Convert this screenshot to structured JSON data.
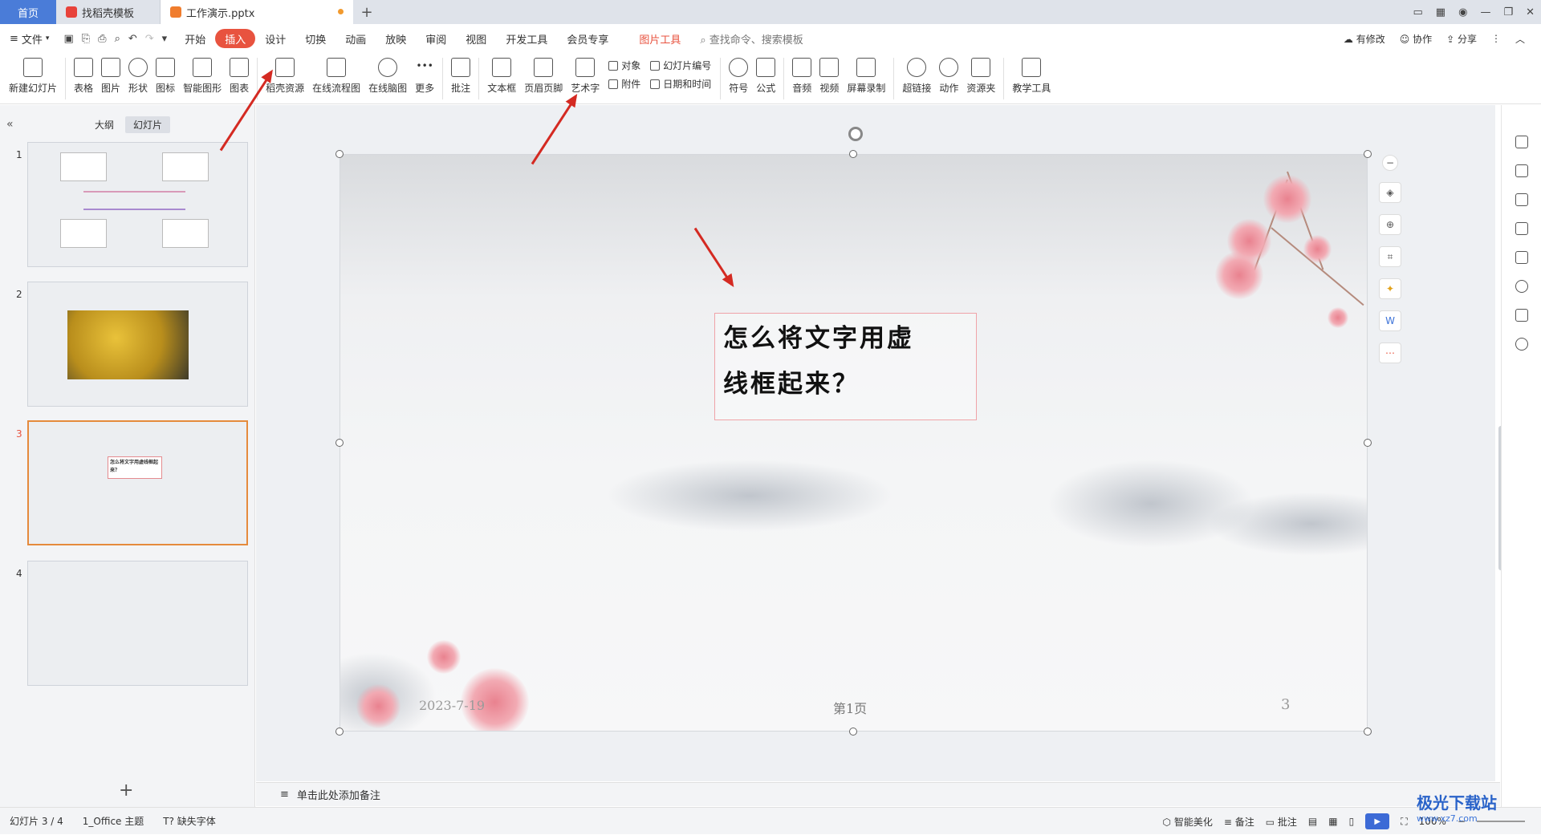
{
  "tabs": {
    "home": "首页",
    "template": "找稻壳模板",
    "document": "工作演示.pptx",
    "add": "+"
  },
  "menubar": {
    "file": "文件",
    "items": [
      "开始",
      "插入",
      "设计",
      "切换",
      "动画",
      "放映",
      "审阅",
      "视图",
      "开发工具",
      "会员专享",
      "图片工具"
    ],
    "search_placeholder": "查找命令、搜索模板",
    "right": {
      "changes": "有修改",
      "collab": "协作",
      "share": "分享"
    }
  },
  "ribbon": {
    "new_slide": "新建幻灯片",
    "table": "表格",
    "picture": "图片",
    "shape": "形状",
    "icon": "图标",
    "smart_art": "智能图形",
    "chart": "图表",
    "daoke": "稻壳资源",
    "flowchart": "在线流程图",
    "mindmap": "在线脑图",
    "more": "更多",
    "comment": "批注",
    "textbox": "文本框",
    "header_footer": "页眉页脚",
    "wordart": "艺术字",
    "object": "对象",
    "attachment": "附件",
    "slide_number": "幻灯片编号",
    "datetime": "日期和时间",
    "symbol": "符号",
    "formula": "公式",
    "audio": "音频",
    "video": "视频",
    "screen_record": "屏幕录制",
    "hyperlink": "超链接",
    "action": "动作",
    "resources": "资源夹",
    "teaching": "教学工具"
  },
  "left_panel": {
    "outline": "大纲",
    "slides": "幻灯片",
    "thumbs": [
      {
        "num": "1"
      },
      {
        "num": "2"
      },
      {
        "num": "3",
        "text": "怎么将文字用虚线框起来？"
      },
      {
        "num": "4"
      }
    ],
    "add": "+"
  },
  "slide": {
    "textbox_line1": "怎么将文字用虚",
    "textbox_line2": "线框起来？",
    "date": "2023-7-19",
    "page_label": "第1页",
    "page_number": "3"
  },
  "notes": {
    "placeholder": "单击此处添加备注"
  },
  "status": {
    "slide_count": "幻灯片 3 / 4",
    "theme": "1_Office 主题",
    "missing_font": "缺失字体",
    "beautify": "智能美化",
    "notes": "备注",
    "comments": "批注",
    "zoom": "100%"
  },
  "watermark": {
    "title": "极光下载站",
    "url": "www.xz7.com"
  },
  "colors": {
    "accent": "#e8533f",
    "home_tab": "#4a7cd8",
    "arrow": "#d42a22"
  }
}
